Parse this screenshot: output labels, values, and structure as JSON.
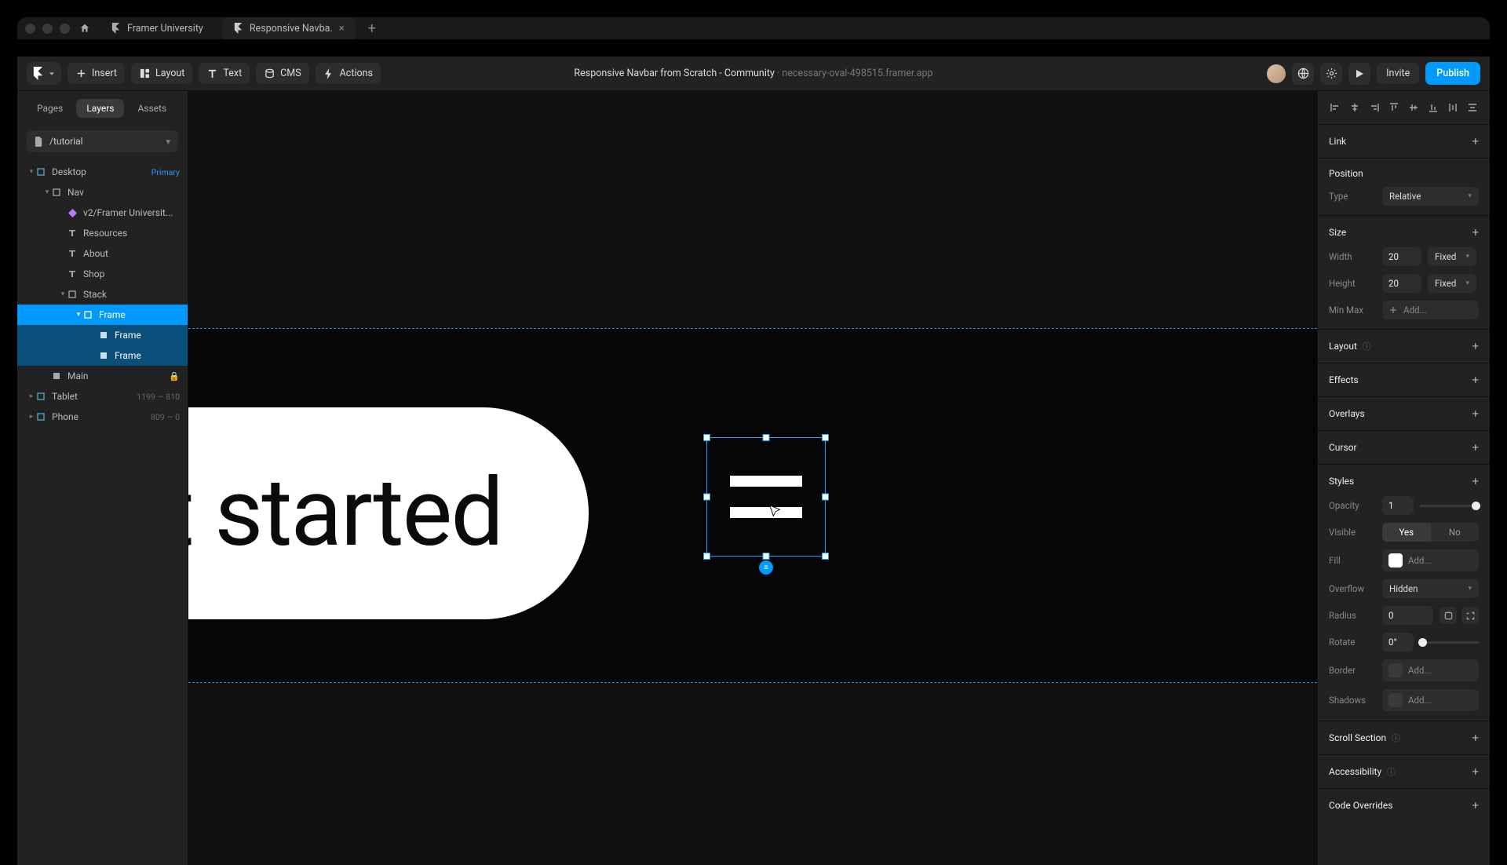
{
  "tabs": {
    "t1": "Framer University",
    "t2": "Responsive Navba."
  },
  "toolbar": {
    "insert": "Insert",
    "layout": "Layout",
    "text": "Text",
    "cms": "CMS",
    "actions": "Actions",
    "title": "Responsive Navbar from Scratch - Community",
    "subtitle": "necessary-oval-498515.framer.app",
    "invite": "Invite",
    "publish": "Publish"
  },
  "left": {
    "tabs": {
      "pages": "Pages",
      "layers": "Layers",
      "assets": "Assets"
    },
    "page": "/tutorial",
    "tree": {
      "desktop": "Desktop",
      "primary": "Primary",
      "nav": "Nav",
      "v2": "v2/Framer Universit...",
      "resources": "Resources",
      "about": "About",
      "shop": "Shop",
      "stack": "Stack",
      "frame": "Frame",
      "frame2": "Frame",
      "frame3": "Frame",
      "main": "Main",
      "tablet": "Tablet",
      "tablet_meta": "1199 — 810",
      "phone": "Phone",
      "phone_meta": "809 — 0"
    }
  },
  "canvas": {
    "pill_text": "t started"
  },
  "right": {
    "link": "Link",
    "position": "Position",
    "type": "Type",
    "type_val": "Relative",
    "size": "Size",
    "width": "Width",
    "width_val": "20",
    "width_mode": "Fixed",
    "height": "Height",
    "height_val": "20",
    "height_mode": "Fixed",
    "minmax": "Min Max",
    "minmax_add": "Add...",
    "layout": "Layout",
    "effects": "Effects",
    "overlays": "Overlays",
    "cursor": "Cursor",
    "styles": "Styles",
    "opacity": "Opacity",
    "opacity_val": "1",
    "visible": "Visible",
    "yes": "Yes",
    "no": "No",
    "fill": "Fill",
    "fill_add": "Add...",
    "overflow": "Overflow",
    "overflow_val": "Hidden",
    "radius": "Radius",
    "radius_val": "0",
    "rotate": "Rotate",
    "rotate_val": "0°",
    "border": "Border",
    "border_add": "Add...",
    "shadows": "Shadows",
    "shadows_add": "Add...",
    "scroll": "Scroll Section",
    "a11y": "Accessibility",
    "code": "Code Overrides"
  }
}
